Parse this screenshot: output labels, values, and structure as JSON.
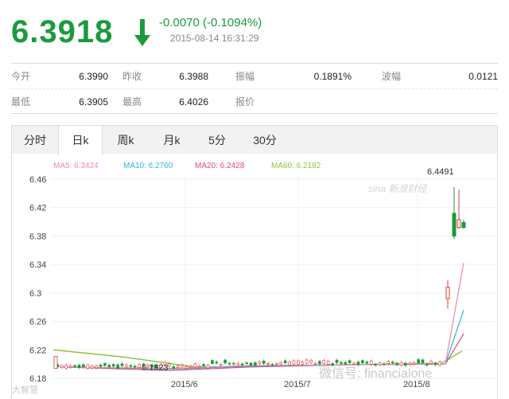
{
  "header": {
    "price": "6.3918",
    "change": "-0.0070 (-0.1094%)",
    "timestamp": "2015-08-14 16:31:29",
    "color_down": "#1a9a3c"
  },
  "quote": {
    "row1": [
      {
        "label": "今开",
        "value": "6.3990"
      },
      {
        "label": "昨收",
        "value": "6.3988"
      },
      {
        "label": "振幅",
        "value": "0.1891%"
      },
      {
        "label": "波幅",
        "value": "0.0121"
      }
    ],
    "row2": [
      {
        "label": "最低",
        "value": "6.3905"
      },
      {
        "label": "最高",
        "value": "6.4026"
      },
      {
        "label": "报价",
        "value": ""
      }
    ]
  },
  "tabs": [
    "分时",
    "日k",
    "周k",
    "月k",
    "5分",
    "30分"
  ],
  "active_tab": "日k",
  "chart": {
    "ma_legend": [
      {
        "text": "MA5: 6.3424",
        "color": "#f08aa6"
      },
      {
        "text": "MA10: 6.2760",
        "color": "#2ab6d6"
      },
      {
        "text": "MA20: 6.2428",
        "color": "#e04a74"
      },
      {
        "text": "MA60: 6.2182",
        "color": "#8cc63f"
      }
    ],
    "high_label": "6.4491",
    "low_label": "6.1923",
    "watermark_top": "sina 新浪财经",
    "watermark_bottom": "微信号: financialone",
    "watermark_left": "大智慧"
  },
  "chart_data": {
    "type": "candlestick",
    "y_ticks": [
      "6.46",
      "6.42",
      "6.38",
      "6.34",
      "6.3",
      "6.26",
      "6.22",
      "6.18"
    ],
    "ylim": [
      6.18,
      6.46
    ],
    "x_ticks": [
      "2015/6",
      "2015/7",
      "2015/8"
    ],
    "series": [
      {
        "name": "MA5",
        "values_end": 6.3424
      },
      {
        "name": "MA10",
        "values_end": 6.276
      },
      {
        "name": "MA20",
        "values_end": 6.2428
      },
      {
        "name": "MA60",
        "values_end": 6.2182
      }
    ],
    "max_marker": 6.4491,
    "min_marker": 6.1923
  }
}
